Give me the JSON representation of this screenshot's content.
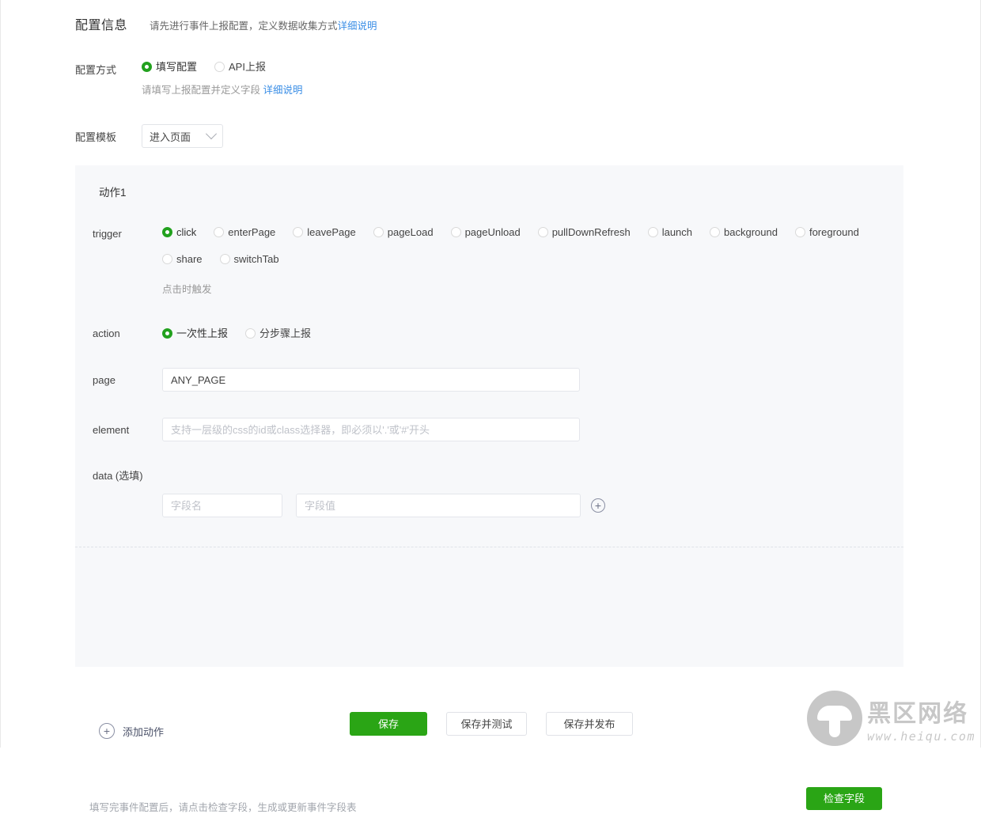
{
  "header": {
    "title": "配置信息",
    "subtitle": "请先进行事件上报配置，定义数据收集方式",
    "subtitle_link": "详细说明"
  },
  "config_method": {
    "label": "配置方式",
    "options": [
      {
        "label": "填写配置",
        "checked": true
      },
      {
        "label": "API上报",
        "checked": false
      }
    ],
    "hint": "请填写上报配置并定义字段",
    "hint_link": "详细说明"
  },
  "config_template": {
    "label": "配置模板",
    "selected": "进入页面",
    "options": [
      "进入页面"
    ]
  },
  "action_card": {
    "title": "动作1",
    "trigger": {
      "label": "trigger",
      "options": [
        {
          "label": "click",
          "checked": true
        },
        {
          "label": "enterPage",
          "checked": false
        },
        {
          "label": "leavePage",
          "checked": false
        },
        {
          "label": "pageLoad",
          "checked": false
        },
        {
          "label": "pageUnload",
          "checked": false
        },
        {
          "label": "pullDownRefresh",
          "checked": false
        },
        {
          "label": "launch",
          "checked": false
        },
        {
          "label": "background",
          "checked": false
        },
        {
          "label": "foreground",
          "checked": false
        },
        {
          "label": "share",
          "checked": false
        },
        {
          "label": "switchTab",
          "checked": false
        }
      ],
      "hint": "点击时触发"
    },
    "action": {
      "label": "action",
      "options": [
        {
          "label": "一次性上报",
          "checked": true
        },
        {
          "label": "分步骤上报",
          "checked": false
        }
      ]
    },
    "page": {
      "label": "page",
      "value": "ANY_PAGE",
      "placeholder": "ANY_PAGE"
    },
    "element": {
      "label": "element",
      "value": "",
      "placeholder": "支持一层级的css的id或class选择器，即必须以'.'或'#'开头"
    },
    "data": {
      "label": "data (选填)",
      "field_name_placeholder": "字段名",
      "field_name_value": "",
      "field_value_placeholder": "字段值",
      "field_value_value": "",
      "add_icon": "plus-circle-icon"
    },
    "add_action": {
      "label": "添加动作",
      "icon": "plus-circle-icon"
    },
    "footer_note": "填写完事件配置后，请点击检查字段，生成或更新事件字段表",
    "check_button": "检查字段"
  },
  "bottom_buttons": {
    "save": "保存",
    "save_and_test": "保存并测试",
    "save_and_publish": "保存并发布"
  },
  "watermark": {
    "name": "黑区网络",
    "url": "www.heiqu.com"
  },
  "colors": {
    "accent_green": "#2aa515",
    "radio_green": "#22a11e",
    "link_blue": "#3a8ee6",
    "card_bg": "#f7f8fa"
  }
}
